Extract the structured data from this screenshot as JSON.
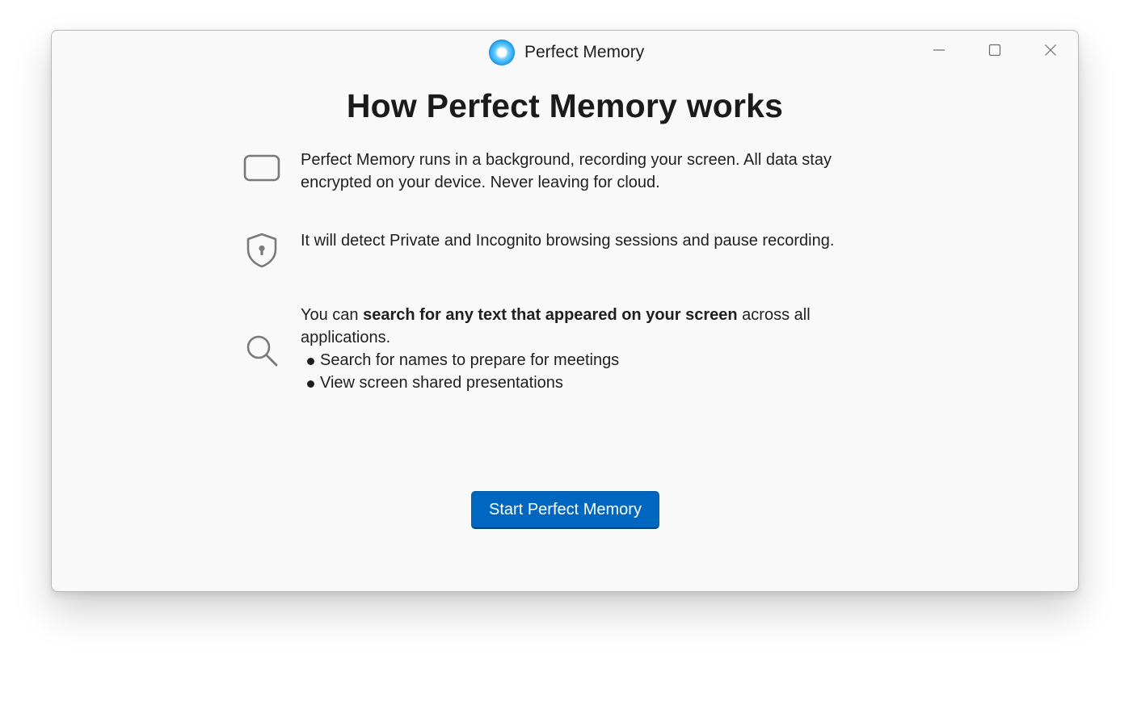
{
  "window": {
    "title": "Perfect Memory",
    "logo_icon": "perfect-memory-logo-icon",
    "controls": {
      "minimize_icon": "minimize-icon",
      "maximize_icon": "maximize-icon",
      "close_icon": "close-icon"
    }
  },
  "main": {
    "heading": "How Perfect Memory works",
    "features": [
      {
        "icon": "screen-icon",
        "text": "Perfect Memory runs in a background, recording your screen. All data stay encrypted on your device. Never leaving for cloud."
      },
      {
        "icon": "shield-lock-icon",
        "text": "It will detect Private and Incognito browsing sessions and pause recording."
      },
      {
        "icon": "search-icon",
        "text_prefix": "You can ",
        "text_bold": "search for any text that appeared on your screen",
        "text_suffix": " across all applications.",
        "bullets": [
          "Search for names to prepare for meetings",
          "View screen shared presentations"
        ]
      }
    ],
    "start_button_label": "Start Perfect Memory"
  },
  "colors": {
    "accent": "#0067c0",
    "window_bg": "#f9f9f9",
    "icon_gray": "#7a7a7a",
    "logo_blue": "#1a9cf0"
  }
}
